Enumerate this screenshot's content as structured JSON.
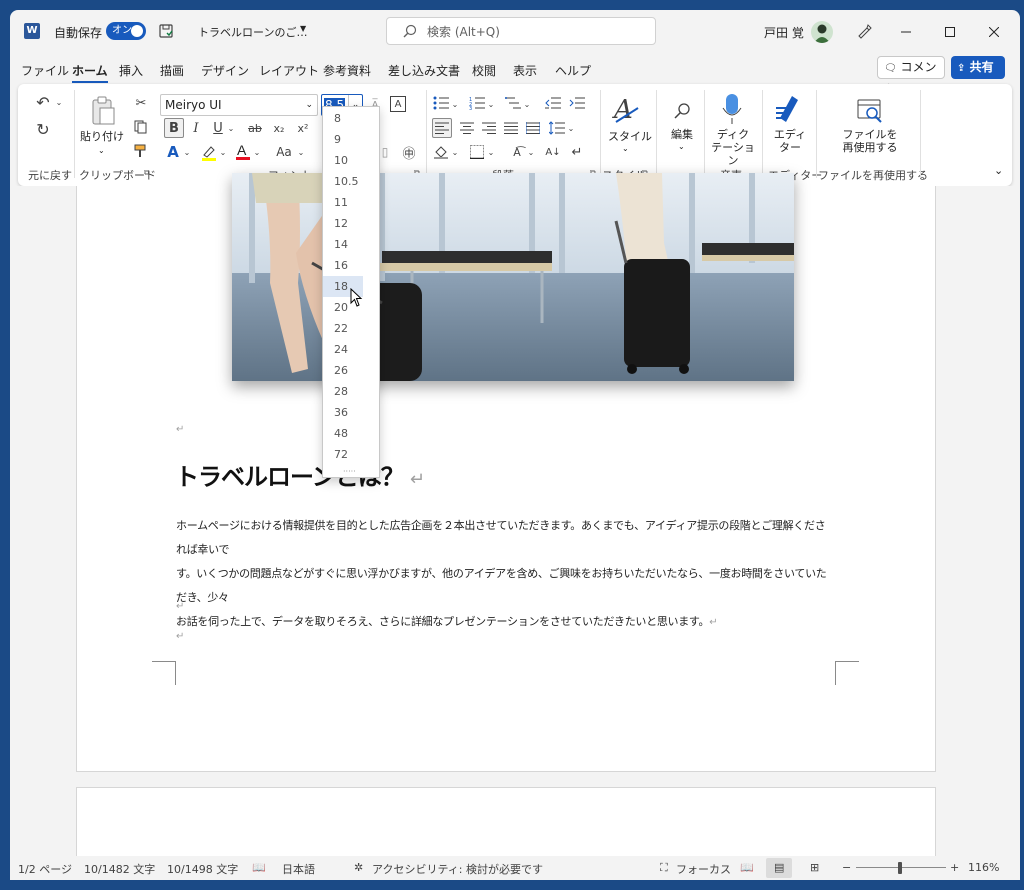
{
  "titlebar": {
    "autosave_label": "自動保存",
    "autosave_state": "オン",
    "doc_title": "トラベルローンのご…",
    "search_placeholder": "検索 (Alt+Q)",
    "user_name": "戸田 覚"
  },
  "menu": {
    "items": [
      "ファイル",
      "ホーム",
      "挿入",
      "描画",
      "デザイン",
      "レイアウト",
      "参考資料",
      "差し込み文書",
      "校閲",
      "表示",
      "ヘルプ"
    ],
    "active": "ホーム",
    "comment_label": "コメント",
    "share_label": "共有"
  },
  "ribbon": {
    "undo_group": "元に戻す",
    "clipboard": {
      "paste_label": "貼り付け",
      "group": "クリップボード"
    },
    "font": {
      "name": "Meiryo UI",
      "size_selected": "8.5",
      "group": "フォント",
      "case_label": "Aa"
    },
    "paragraph_group": "段落",
    "styles": {
      "label": "スタイル",
      "group": "スタイル"
    },
    "editing": {
      "label": "編集"
    },
    "voice": {
      "label": "ディク\nテーション",
      "group": "音声"
    },
    "editor": {
      "label": "エディ\nター",
      "group": "エディター"
    },
    "reuse": {
      "label": "ファイルを\n再使用する",
      "group": "ファイルを再使用する"
    }
  },
  "font_size_dropdown": [
    "8",
    "9",
    "10",
    "10.5",
    "11",
    "12",
    "14",
    "16",
    "18",
    "20",
    "22",
    "24",
    "26",
    "28",
    "36",
    "48",
    "72"
  ],
  "font_size_hover": "18",
  "document": {
    "heading": "トラベルローンとは？",
    "body_lines": [
      "ホームページにおける情報提供を目的とした広告企画を２本出させていただきます。あくまでも、アイディア提示の段階とご理解くだされば幸いで",
      "す。いくつかの問題点などがすぐに思い浮かびますが、他のアイデアを含め、ご興味をお持ちいただいたなら、一度お時間をさいていただき、少々",
      "お話を伺った上で、データを取りそろえ、さらに詳細なプレゼンテーションをさせていただきたいと思います。"
    ]
  },
  "status": {
    "page": "1/2 ページ",
    "words_selected": "10/1482 文字",
    "chars": "10/1498 文字",
    "language": "日本語",
    "accessibility": "アクセシビリティ: 検討が必要です",
    "focus": "フォーカス",
    "zoom": "116%"
  },
  "colors": {
    "accent": "#185abd",
    "word_icon": "#2b579a",
    "highlight_yellow": "#ffff00",
    "font_red": "#e81123"
  }
}
